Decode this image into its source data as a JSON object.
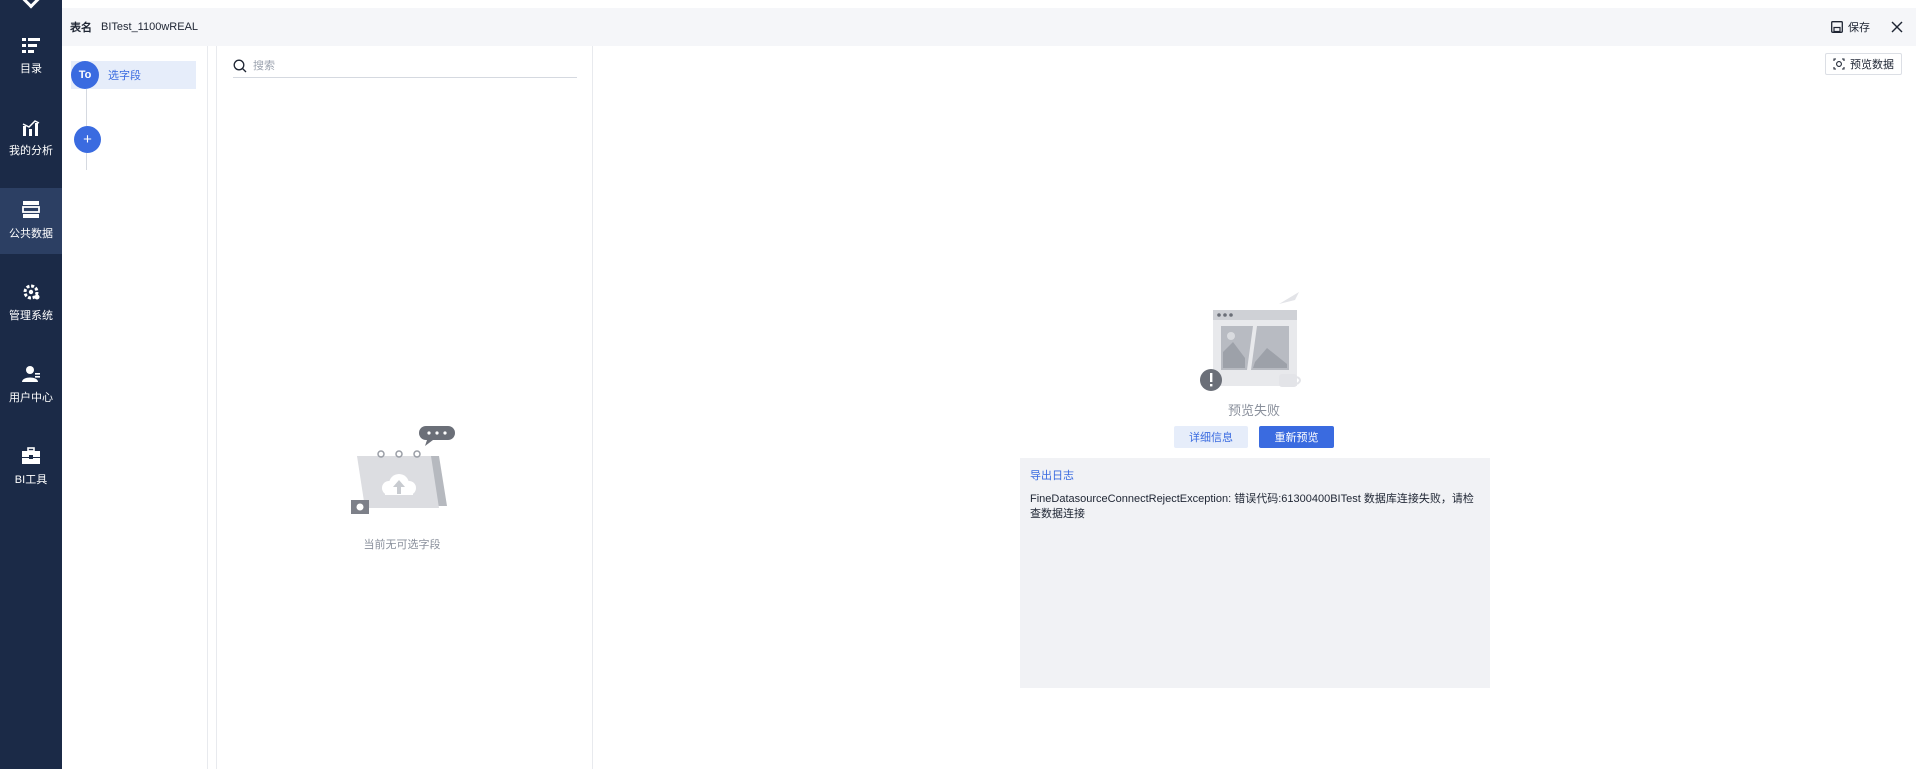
{
  "nav": {
    "items": [
      {
        "label": "目录",
        "icon": "catalog-icon"
      },
      {
        "label": "我的分析",
        "icon": "analysis-icon"
      },
      {
        "label": "公共数据",
        "icon": "public-data-icon",
        "active": true
      },
      {
        "label": "管理系统",
        "icon": "gear-icon"
      },
      {
        "label": "用户中心",
        "icon": "user-icon"
      },
      {
        "label": "BI工具",
        "icon": "toolbox-icon"
      }
    ]
  },
  "header": {
    "table_name_label": "表名",
    "table_name": "BITest_1100wREAL",
    "save_label": "保存"
  },
  "steps": {
    "step1_badge": "To",
    "step1_label": "选字段",
    "add_label": "+"
  },
  "fields": {
    "search_placeholder": "搜索",
    "empty_text": "当前无可选字段"
  },
  "preview": {
    "preview_data_label": "预览数据",
    "fail_text": "预览失败",
    "detail_label": "详细信息",
    "repreview_label": "重新预览",
    "export_log_label": "导出日志",
    "error_message": "FineDatasourceConnectRejectException: 错误代码:61300400BITest 数据库连接失败，请检查数据连接"
  },
  "colors": {
    "nav_bg": "#1b2a47",
    "nav_active": "#2c3f63",
    "accent": "#3a6be0",
    "log_bg": "#f1f2f5"
  }
}
